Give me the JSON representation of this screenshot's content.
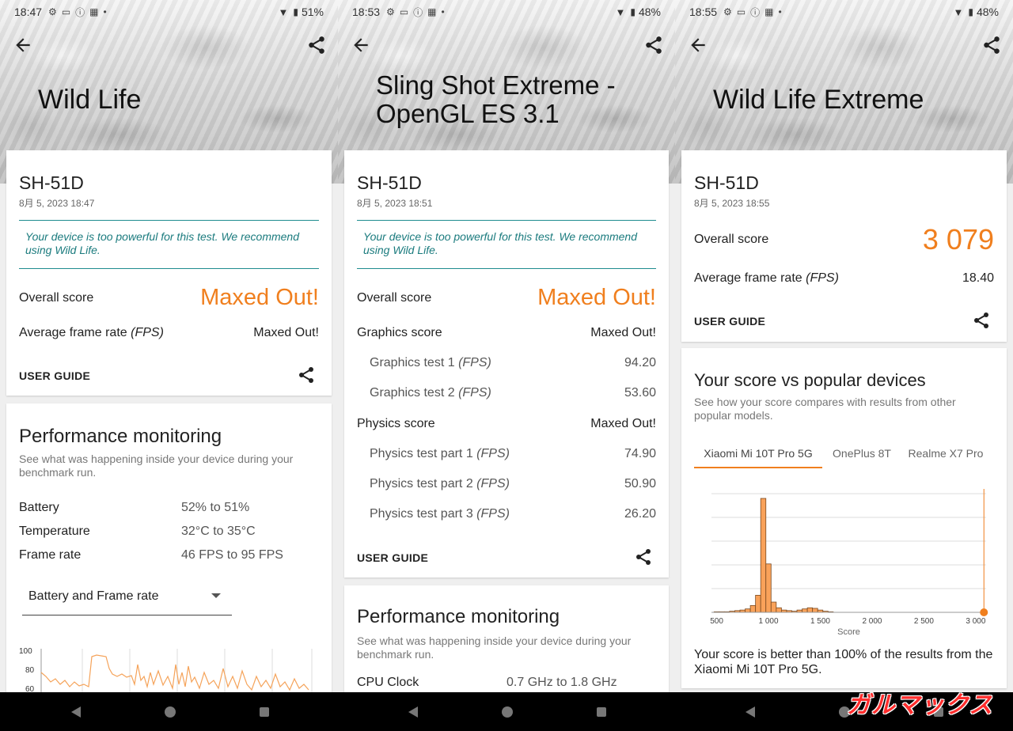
{
  "panels": [
    {
      "status": {
        "time": "18:47",
        "battery": "51%"
      },
      "title": "Wild Life",
      "device": "SH-51D",
      "date": "8月 5, 2023 18:47",
      "notice": "Your device is too powerful for this test. We recommend using Wild Life.",
      "overall_label": "Overall score",
      "overall_value": "Maxed Out!",
      "fps_label": "Average frame rate",
      "fps_unit": "(FPS)",
      "fps_value": "Maxed Out!",
      "user_guide": "USER GUIDE",
      "perf": {
        "title": "Performance monitoring",
        "desc": "See what was happening inside your device during your benchmark run.",
        "rows": [
          {
            "label": "Battery",
            "value": "52% to 51%"
          },
          {
            "label": "Temperature",
            "value": "32°C to 35°C"
          },
          {
            "label": "Frame rate",
            "value": "46 FPS to 95 FPS"
          }
        ],
        "dropdown": "Battery and Frame rate",
        "yticks": [
          "100",
          "80",
          "60"
        ]
      }
    },
    {
      "status": {
        "time": "18:53",
        "battery": "48%"
      },
      "title_line1": "Sling Shot Extreme -",
      "title_line2": "OpenGL ES 3.1",
      "device": "SH-51D",
      "date": "8月 5, 2023 18:51",
      "notice": "Your device is too powerful for this test. We recommend using Wild Life.",
      "overall_label": "Overall score",
      "overall_value": "Maxed Out!",
      "graphics_label": "Graphics score",
      "graphics_value": "Maxed Out!",
      "graphics_tests": [
        {
          "label": "Graphics test 1",
          "unit": "(FPS)",
          "value": "94.20"
        },
        {
          "label": "Graphics test 2",
          "unit": "(FPS)",
          "value": "53.60"
        }
      ],
      "physics_label": "Physics score",
      "physics_value": "Maxed Out!",
      "physics_tests": [
        {
          "label": "Physics test part 1",
          "unit": "(FPS)",
          "value": "74.90"
        },
        {
          "label": "Physics test part 2",
          "unit": "(FPS)",
          "value": "50.90"
        },
        {
          "label": "Physics test part 3",
          "unit": "(FPS)",
          "value": "26.20"
        }
      ],
      "user_guide": "USER GUIDE",
      "perf": {
        "title": "Performance monitoring",
        "desc": "See what was happening inside your device during your benchmark run.",
        "cpu_label": "CPU Clock",
        "cpu_value": "0.7 GHz to 1.8 GHz"
      }
    },
    {
      "status": {
        "time": "18:55",
        "battery": "48%"
      },
      "title": "Wild Life Extreme",
      "device": "SH-51D",
      "date": "8月 5, 2023 18:55",
      "overall_label": "Overall score",
      "overall_value": "3 079",
      "fps_label": "Average frame rate",
      "fps_unit": "(FPS)",
      "fps_value": "18.40",
      "user_guide": "USER GUIDE",
      "compare": {
        "title": "Your score vs popular devices",
        "desc": "See how your score compares with results from other popular models.",
        "tabs": [
          "Xiaomi Mi 10T Pro 5G",
          "OnePlus 8T",
          "Realme X7 Pro"
        ],
        "xlabel": "Score",
        "result": "Your score is better than 100% of the results from the Xiaomi Mi 10T Pro 5G."
      }
    }
  ],
  "chart_data": {
    "type": "bar",
    "xlabel": "Score",
    "xlim": [
      450,
      3100
    ],
    "xticks": [
      "500",
      "1 000",
      "1 500",
      "2 000",
      "2 500",
      "3 000"
    ],
    "xtick_values": [
      500,
      1000,
      1500,
      2000,
      2500,
      3000
    ],
    "bins_x": [
      500,
      550,
      600,
      650,
      700,
      750,
      800,
      850,
      900,
      950,
      1000,
      1050,
      1100,
      1150,
      1200,
      1250,
      1300,
      1350,
      1400,
      1450,
      1500,
      1550,
      1600
    ],
    "bins_y": [
      1,
      1,
      1,
      2,
      3,
      4,
      6,
      12,
      30,
      200,
      85,
      18,
      8,
      4,
      3,
      2,
      4,
      6,
      8,
      7,
      4,
      2,
      1
    ],
    "your_score": 3079,
    "colors": {
      "bar": "#f9a25a",
      "bar_stroke": "#7a4a20",
      "marker": "#f07f1e"
    }
  },
  "colors": {
    "accent": "#f07f1e",
    "notice": "#1b7b7e"
  },
  "watermark": "ガルマックス"
}
